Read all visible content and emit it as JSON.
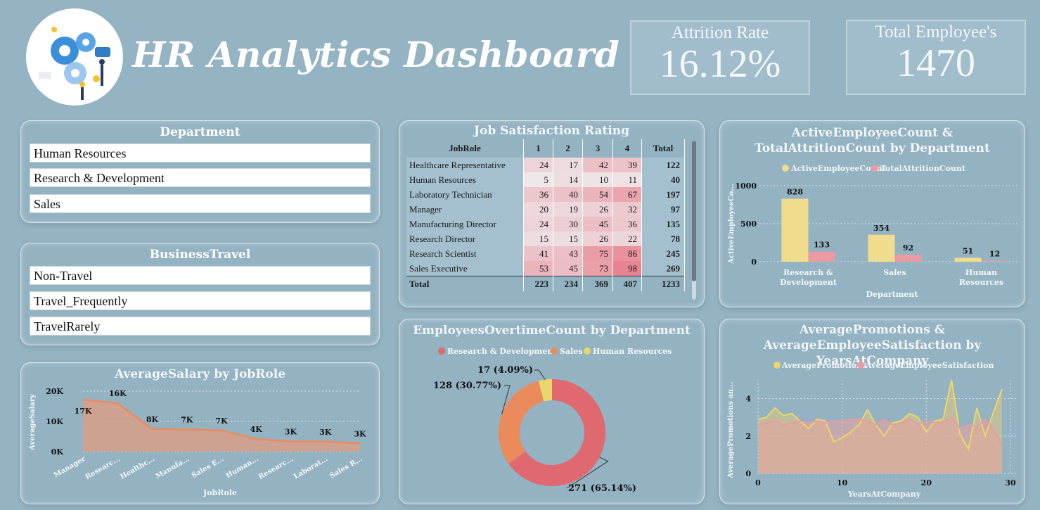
{
  "header": {
    "title": "HR Analytics Dashboard",
    "kpis": [
      {
        "label": "Attrition Rate",
        "value": "16.12%"
      },
      {
        "label": "Total Employee's",
        "value": "1470"
      }
    ]
  },
  "slicers": {
    "department": {
      "title": "Department",
      "items": [
        "Human Resources",
        "Research & Development",
        "Sales"
      ]
    },
    "business_travel": {
      "title": "BusinessTravel",
      "items": [
        "Non-Travel",
        "Travel_Frequently",
        "TravelRarely"
      ]
    }
  },
  "colors": {
    "background": "#94b3c3",
    "yellow": "#f0dc8c",
    "pink": "#e99aa2",
    "orange": "#ec8a5c",
    "red_donut": "#e0686f",
    "orange_donut": "#eb8a5b",
    "yellow_donut": "#ecd56a"
  },
  "job_satisfaction": {
    "title": "Job Satisfaction Rating",
    "columns": [
      "JobRole",
      "1",
      "2",
      "3",
      "4",
      "Total"
    ],
    "rows": [
      [
        "Healthcare Representative",
        24,
        17,
        42,
        39,
        122
      ],
      [
        "Human Resources",
        5,
        14,
        10,
        11,
        40
      ],
      [
        "Laboratory Technician",
        36,
        40,
        54,
        67,
        197
      ],
      [
        "Manager",
        20,
        19,
        26,
        32,
        97
      ],
      [
        "Manufacturing Director",
        24,
        30,
        45,
        36,
        135
      ],
      [
        "Research Director",
        15,
        15,
        26,
        22,
        78
      ],
      [
        "Research Scientist",
        41,
        43,
        75,
        86,
        245
      ],
      [
        "Sales Executive",
        53,
        45,
        73,
        98,
        269
      ]
    ],
    "total": [
      "Total",
      223,
      234,
      369,
      407,
      1233
    ]
  },
  "chart_data": [
    {
      "id": "active_vs_attrition",
      "type": "bar",
      "title": "ActiveEmployeeCount & TotalAttritionCount by Department",
      "categories": [
        "Research & Development",
        "Sales",
        "Human Resources"
      ],
      "category_lines": [
        [
          "Research &",
          "Development"
        ],
        [
          "Sales"
        ],
        [
          "Human",
          "Resources"
        ]
      ],
      "series": [
        {
          "name": "ActiveEmployeeCount",
          "values": [
            828,
            354,
            51
          ]
        },
        {
          "name": "TotalAttritionCount",
          "values": [
            133,
            92,
            12
          ]
        }
      ],
      "xlabel": "Department",
      "ylabel": "ActiveEmployeeCo...",
      "ylim": [
        0,
        1000
      ],
      "yticks": [
        0,
        500,
        1000
      ],
      "legend": "top",
      "grid": true
    },
    {
      "id": "overtime_by_department",
      "type": "pie",
      "title": "EmployeesOvertimeCount by Department",
      "labels": [
        "Research & Development",
        "Sales",
        "Human Resources"
      ],
      "values": [
        271,
        128,
        17
      ],
      "data_labels": [
        "271 (65.14%)",
        "128 (30.77%)",
        "17 (4.09%)"
      ],
      "legend": "top"
    },
    {
      "id": "avg_salary_by_jobrole",
      "type": "area",
      "title": "AverageSalary by JobRole",
      "categories": [
        "Manager",
        "Researc...",
        "Healthc...",
        "Manufa...",
        "Sales E...",
        "Human...",
        "Researc...",
        "Laborat...",
        "Sales R..."
      ],
      "values": [
        17200,
        16000,
        7500,
        7300,
        7000,
        4200,
        3400,
        3300,
        2700
      ],
      "data_labels": [
        "17K",
        "16K",
        "8K",
        "7K",
        "7K",
        "4K",
        "3K",
        "3K",
        "3K"
      ],
      "xlabel": "JobRole",
      "ylabel": "AverageSalary",
      "ylim": [
        0,
        20000
      ],
      "yticks": [
        "0K",
        "10K",
        "20K"
      ],
      "grid": true
    },
    {
      "id": "promotions_satisfaction_by_years",
      "type": "area",
      "title": "AveragePromotions & AverageEmployeeSatisfaction by YearsAtCompany",
      "x": [
        0,
        1,
        2,
        3,
        4,
        5,
        6,
        7,
        8,
        9,
        10,
        11,
        12,
        13,
        14,
        15,
        16,
        17,
        18,
        19,
        20,
        21,
        22,
        23,
        24,
        25,
        26,
        27,
        28,
        29
      ],
      "series": [
        {
          "name": "AveragePromotions",
          "values": [
            2.9,
            3.0,
            3.5,
            3.1,
            3.2,
            2.8,
            2.4,
            2.9,
            2.8,
            1.7,
            1.9,
            2.2,
            2.6,
            3.4,
            2.6,
            2.0,
            2.7,
            2.8,
            3.2,
            3.0,
            2.2,
            2.8,
            2.9,
            5.0,
            2.1,
            1.3,
            3.5,
            2.0,
            3.3,
            4.5
          ]
        },
        {
          "name": "AverageEmployeeSatisfaction",
          "values": [
            2.6,
            2.7,
            2.8,
            2.6,
            2.7,
            2.8,
            2.7,
            2.8,
            2.7,
            2.8,
            2.8,
            2.9,
            2.9,
            2.8,
            2.6,
            2.9,
            2.6,
            2.7,
            2.9,
            2.6,
            2.8,
            2.7,
            2.7,
            3.0,
            2.4,
            2.6,
            2.5,
            2.9,
            2.4,
            1.5
          ]
        }
      ],
      "xlabel": "YearsAtCompany",
      "ylabel": "AveragePromotions an...",
      "xticks": [
        0,
        10,
        20,
        30
      ],
      "ylim": [
        0,
        5
      ],
      "yticks": [
        0,
        2,
        4
      ],
      "legend": "top",
      "grid": true
    }
  ]
}
